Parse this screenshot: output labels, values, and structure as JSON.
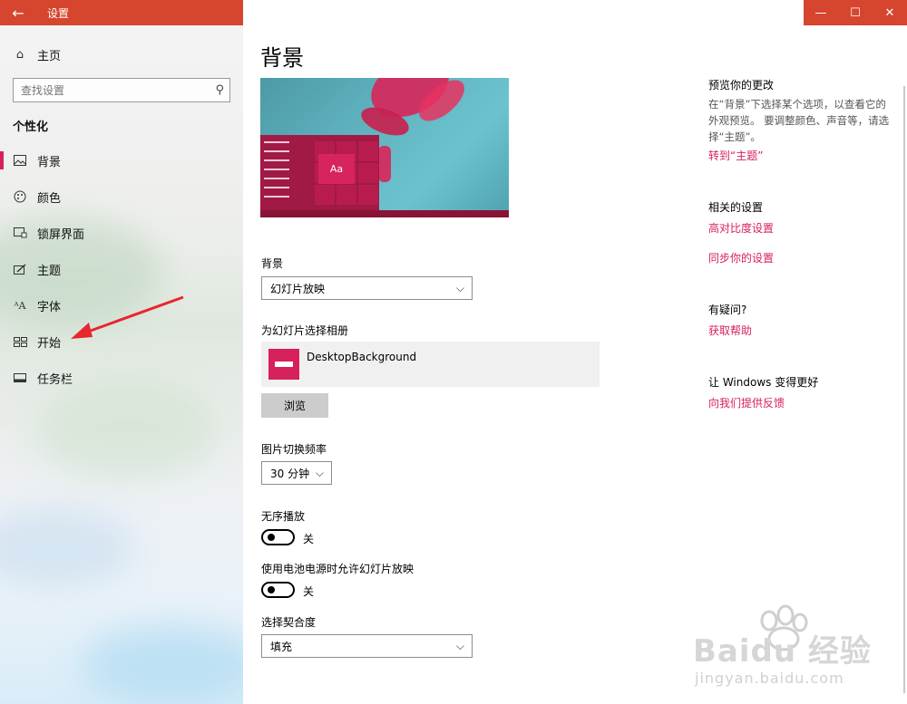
{
  "window": {
    "title": "设置",
    "back_icon": "arrow-left-icon"
  },
  "controls": {
    "minimize": "—",
    "maximize": "☐",
    "close": "✕"
  },
  "sidebar": {
    "home_label": "主页",
    "search_placeholder": "查找设置",
    "section_title": "个性化",
    "items": [
      {
        "label": "背景",
        "icon": "picture-icon",
        "selected": true
      },
      {
        "label": "颜色",
        "icon": "palette-icon",
        "selected": false
      },
      {
        "label": "锁屏界面",
        "icon": "lockscreen-icon",
        "selected": false
      },
      {
        "label": "主题",
        "icon": "theme-icon",
        "selected": false
      },
      {
        "label": "字体",
        "icon": "font-icon",
        "selected": false
      },
      {
        "label": "开始",
        "icon": "start-icon",
        "selected": false
      },
      {
        "label": "任务栏",
        "icon": "taskbar-icon",
        "selected": false
      }
    ]
  },
  "main": {
    "title": "背景",
    "preview": {
      "tile_label": "Aa"
    },
    "background": {
      "label": "背景",
      "value": "幻灯片放映"
    },
    "album": {
      "label": "为幻灯片选择相册",
      "name": "DesktopBackground",
      "browse_label": "浏览"
    },
    "interval": {
      "label": "图片切换频率",
      "value": "30 分钟"
    },
    "shuffle": {
      "label": "无序播放",
      "state_text": "关",
      "on": false
    },
    "battery": {
      "label": "使用电池电源时允许幻灯片放映",
      "state_text": "关",
      "on": false
    },
    "fit": {
      "label": "选择契合度",
      "value": "填充"
    }
  },
  "aside": {
    "preview_head": "预览你的更改",
    "preview_desc": "在“背景”下选择某个选项，以查看它的外观预览。 要调整颜色、声音等，请选择“主题”。",
    "theme_link": "转到“主题”",
    "related_head": "相关的设置",
    "contrast_link": "高对比度设置",
    "sync_link": "同步你的设置",
    "question_head": "有疑问?",
    "help_link": "获取帮助",
    "improve_head": "让 Windows 变得更好",
    "feedback_link": "向我们提供反馈"
  },
  "colors": {
    "accent": "#d6215a",
    "titlebar": "#d6452e"
  },
  "watermark": {
    "brand": "Baidu 经验",
    "url": "jingyan.baidu.com"
  }
}
